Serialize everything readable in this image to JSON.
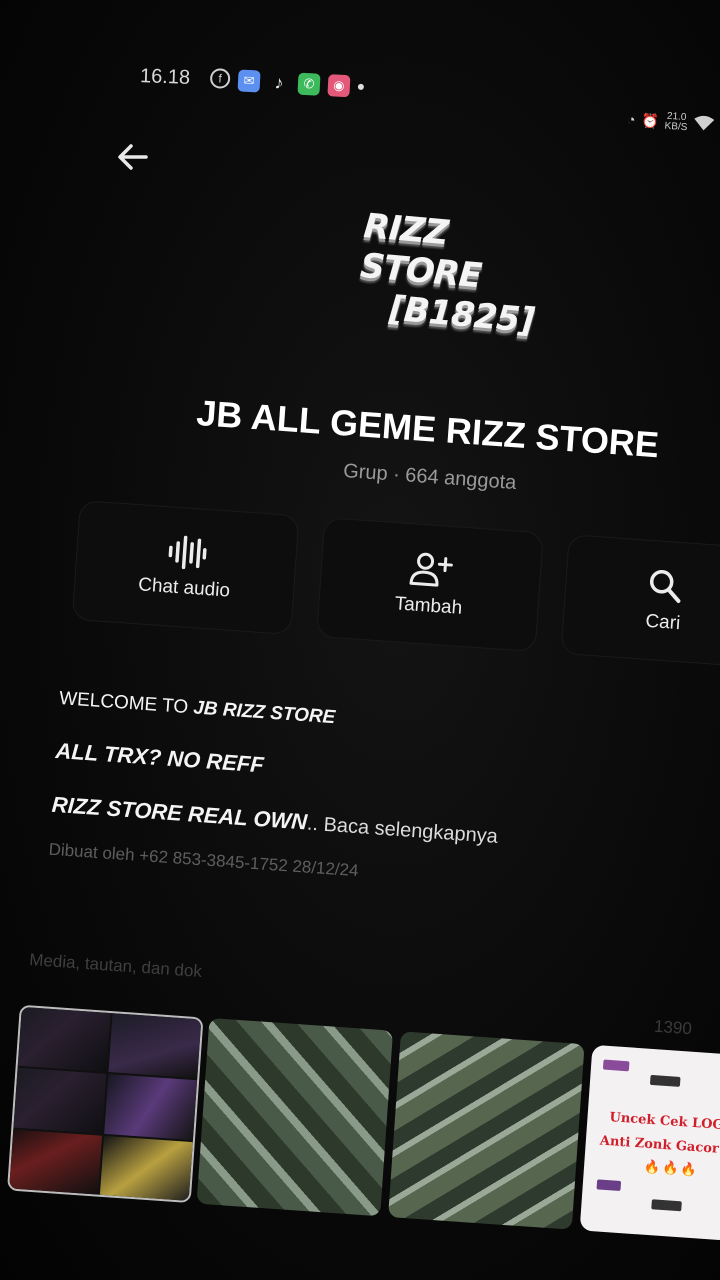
{
  "status_bar": {
    "time": "16.18",
    "notification_icons": [
      "facebook-icon",
      "messenger-icon",
      "tiktok-icon",
      "whatsapp-icon",
      "instagram-icon"
    ],
    "net_speed": "21.0",
    "net_unit": "KB/S"
  },
  "group": {
    "logo_line1": "RIZZ STORE",
    "logo_line2": "[B1825]",
    "name": "JB ALL GEME RIZZ STORE",
    "subtitle": "Grup · 664 anggota"
  },
  "actions": [
    {
      "label": "Chat audio",
      "icon": "audio-wave-icon"
    },
    {
      "label": "Tambah",
      "icon": "add-person-icon"
    },
    {
      "label": "Cari",
      "icon": "search-icon"
    }
  ],
  "description": {
    "line1_prefix": "WELCOME TO ",
    "line1_bold": "JB RIZZ STORE",
    "line2": "ALL TRX? NO REFF",
    "line3_bold": "RIZZ STORE REAL OWN",
    "line3_more": ".. Baca selengkapnya",
    "creator": "Dibuat oleh +62 853-3845-1752 28/12/24"
  },
  "media": {
    "heading": "Media, tautan, dan dok",
    "count": "1390",
    "promo_line1": "Uncek Cek LOG",
    "promo_line2": "Anti Zonk Gacor",
    "promo_fire": "🔥🔥🔥"
  }
}
